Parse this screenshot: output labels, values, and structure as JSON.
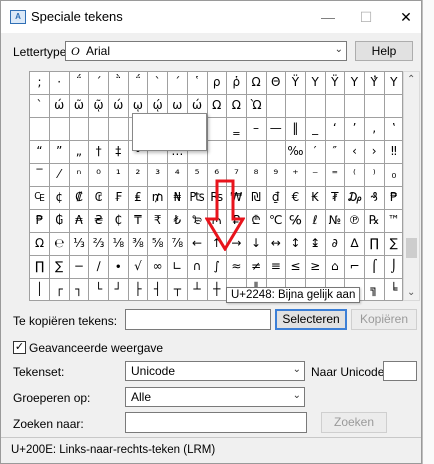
{
  "window": {
    "title": "Speciale tekens",
    "minimize": "—",
    "maximize": "☐",
    "close": "✕"
  },
  "font": {
    "label": "Lettertype:",
    "value": "Arial",
    "help": "Help"
  },
  "grid": {
    "rows": [
      [
        ";",
        "·",
        "΅",
        "΄",
        "῭",
        "΅",
        "`",
        "´",
        "῾",
        "ρ",
        "ῥ",
        "Ω",
        "Θ",
        "Ϋ",
        "Υ",
        "Ÿ",
        "Υ",
        "Υ̓",
        "Υ"
      ],
      [
        "`",
        "ώ",
        "ῶ",
        "ῷ",
        "ώ",
        "ῳ",
        "ῴ",
        "ω",
        "ώ",
        "Ω",
        "Ω",
        "Ὼ",
        "",
        "",
        "",
        "",
        "",
        "",
        ""
      ],
      [
        "",
        "",
        "",
        "",
        "",
        "",
        "",
        "",
        "",
        "",
        "‗",
        "–",
        "—",
        "‖",
        "_",
        "‘",
        "’",
        "‚",
        "‛"
      ],
      [
        "“",
        "”",
        "„",
        "†",
        "‡",
        "•",
        "",
        "…",
        "",
        "",
        "",
        "",
        "",
        "‰",
        "′",
        "″",
        "‹",
        "›",
        "‼"
      ],
      [
        "‾",
        "⁄",
        "ⁿ",
        "⁰",
        "¹",
        "²",
        "³",
        "⁴",
        "⁵",
        "⁶",
        "⁷",
        "⁸",
        "⁹",
        "⁺",
        "⁻",
        "⁼",
        "⁽",
        "⁾",
        "₀"
      ],
      [
        "₠",
        "¢",
        "₡",
        "₢",
        "₣",
        "₤",
        "₥",
        "₦",
        "₧",
        "₨",
        "₩",
        "₪",
        "₫",
        "€",
        "₭",
        "₮",
        "₯",
        "₰",
        "₱"
      ],
      [
        "₱",
        "₲",
        "₳",
        "₴",
        "₵",
        "₸",
        "₹",
        "₺",
        "₻",
        "₼",
        "₽",
        "₾",
        "℃",
        "℅",
        "ℓ",
        "№",
        "℗",
        "℞",
        "™"
      ],
      [
        "Ω",
        "℮",
        "⅓",
        "⅔",
        "⅛",
        "⅜",
        "⅝",
        "⅞",
        "←",
        "↑",
        "→",
        "↓",
        "↔",
        "↕",
        "↨",
        "∂",
        "∆",
        "∏",
        "∑"
      ],
      [
        "∏",
        "∑",
        "−",
        "∕",
        "∙",
        "√",
        "∞",
        "∟",
        "∩",
        "∫",
        "≈",
        "≠",
        "≡",
        "≤",
        "≥",
        "⌂",
        "⌐",
        "⌠",
        "⌡"
      ],
      [
        "│",
        "┌",
        "┐",
        "└",
        "┘",
        "├",
        "┤",
        "┬",
        "┴",
        "┼",
        "═",
        "║",
        "╒",
        "╓",
        "╔",
        "╕",
        "╖",
        "╗",
        "╘"
      ]
    ]
  },
  "tooltip": "U+2248: Bijna gelijk aan",
  "copy": {
    "label": "Te kopiëren tekens:",
    "value": "",
    "select": "Selecteren",
    "copy": "Kopiëren"
  },
  "advanced": {
    "label": "Geavanceerde weergave",
    "checked": "✓"
  },
  "charset": {
    "label": "Tekenset:",
    "value": "Unicode",
    "goto_label": "Naar Unicode:",
    "goto_value": ""
  },
  "group": {
    "label": "Groeperen op:",
    "value": "Alle"
  },
  "search": {
    "label": "Zoeken naar:",
    "value": "",
    "button": "Zoeken"
  },
  "status": "U+200E: Links-naar-rechts-teken (LRM)",
  "colors": {
    "annotation_arrow": "#e8141c",
    "focus": "#3c7fd6"
  }
}
